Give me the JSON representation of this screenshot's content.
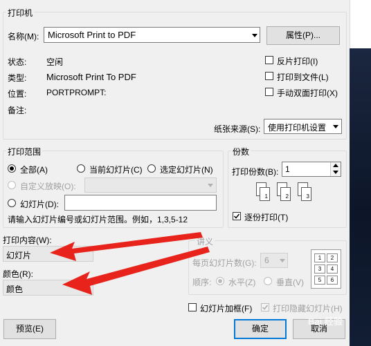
{
  "printer": {
    "group_title": "打印机",
    "name_label": "名称(M):",
    "name_value": "Microsoft Print to PDF",
    "properties_button": "属性(P)...",
    "status_label": "状态:",
    "status_value": "空闲",
    "type_label": "类型:",
    "type_value": "Microsoft Print To PDF",
    "where_label": "位置:",
    "where_value": "PORTPROMPT:",
    "comment_label": "备注:",
    "reverse_print": "反片打印(I)",
    "print_to_file": "打印到文件(L)",
    "manual_duplex": "手动双面打印(X)",
    "paper_source_label": "纸张来源(S):",
    "paper_source_value": "使用打印机设置"
  },
  "print_range": {
    "group_title": "打印范围",
    "all": "全部(A)",
    "current_slide": "当前幻灯片(C)",
    "selected_slides": "选定幻灯片(N)",
    "custom_show": "自定义放映(O):",
    "slides": "幻灯片(D):",
    "slides_value": "",
    "hint": "请输入幻灯片编号或幻灯片范围。例如，1,3,5-12"
  },
  "copies": {
    "group_title": "份数",
    "count_label": "打印份数(B):",
    "count_value": "1",
    "collate": "逐份打印(T)",
    "collate_icons": [
      "1",
      "1",
      "2",
      "2",
      "3",
      "3"
    ]
  },
  "print_what": {
    "label": "打印内容(W):",
    "value": "幻灯片"
  },
  "color": {
    "label": "颜色(R):",
    "value": "颜色"
  },
  "handouts": {
    "group_title": "讲义",
    "per_page_label": "每页幻灯片数(G):",
    "per_page_value": "6",
    "order_label": "顺序:",
    "horizontal": "水平(Z)",
    "vertical": "垂直(V)",
    "preview_numbers": [
      "1",
      "2",
      "3",
      "4",
      "5",
      "6"
    ]
  },
  "options": {
    "frame_slides": "幻灯片加框(F)",
    "print_hidden": "打印隐藏幻灯片(H)"
  },
  "buttons": {
    "preview": "预览(E)",
    "ok": "确定",
    "cancel": "取消"
  },
  "watermark": "Bai 经验",
  "colors": {
    "dialog_bg": "#f0f0f0",
    "arrow_red": "#e8231c",
    "focus_blue": "#0078d7"
  }
}
